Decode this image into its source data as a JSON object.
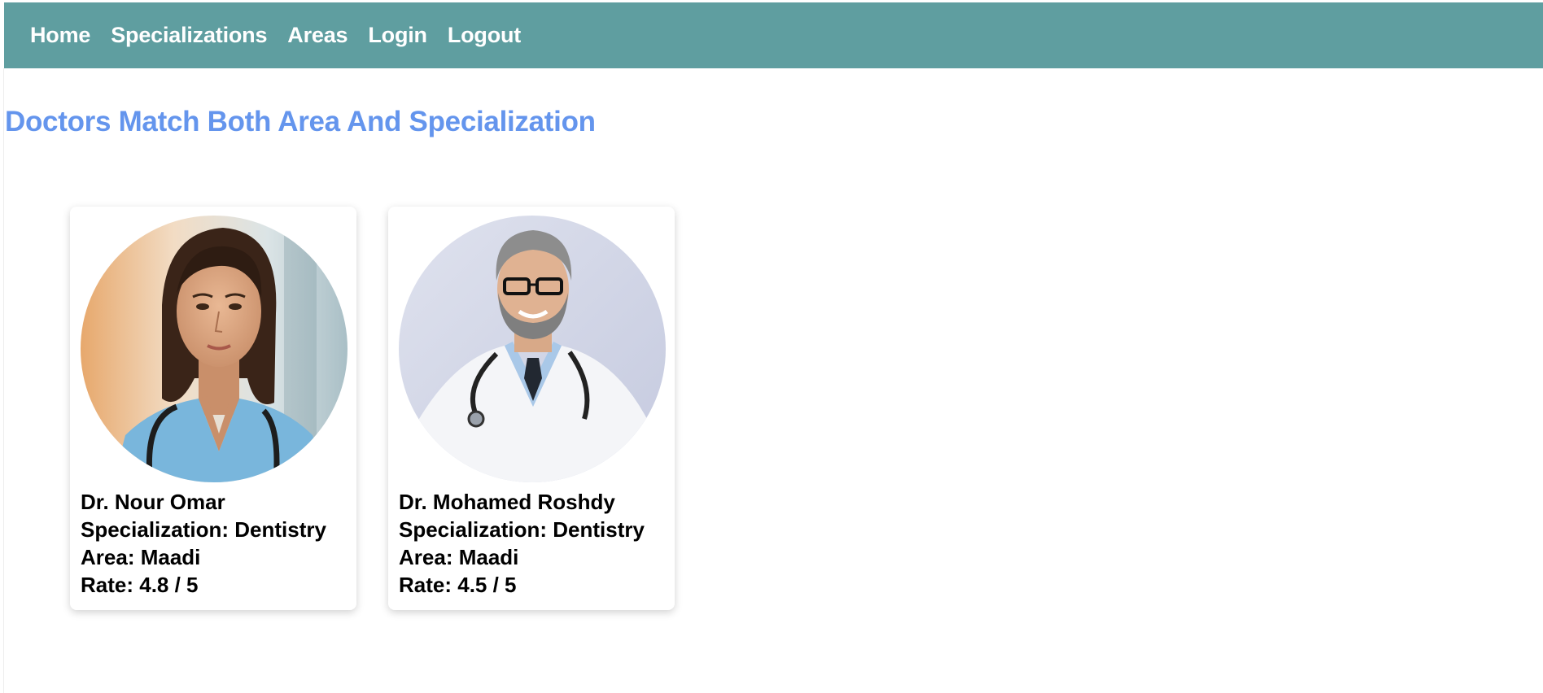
{
  "nav": {
    "items": [
      "Home",
      "Specializations",
      "Areas",
      "Login",
      "Logout"
    ],
    "color": "#5f9ea0"
  },
  "page_title": "Doctors Match Both Area And Specialization",
  "title_color": "#6495ed",
  "doctors": [
    {
      "name": "Dr. Nour Omar",
      "specialization": "Specialization: Dentistry",
      "area": "Area: Maadi",
      "rate": "Rate: 4.8 / 5",
      "photo": "female-doctor-photo"
    },
    {
      "name": "Dr. Mohamed Roshdy",
      "specialization": "Specialization: Dentistry",
      "area": "Area: Maadi",
      "rate": "Rate: 4.5 / 5",
      "photo": "male-doctor-photo"
    }
  ]
}
